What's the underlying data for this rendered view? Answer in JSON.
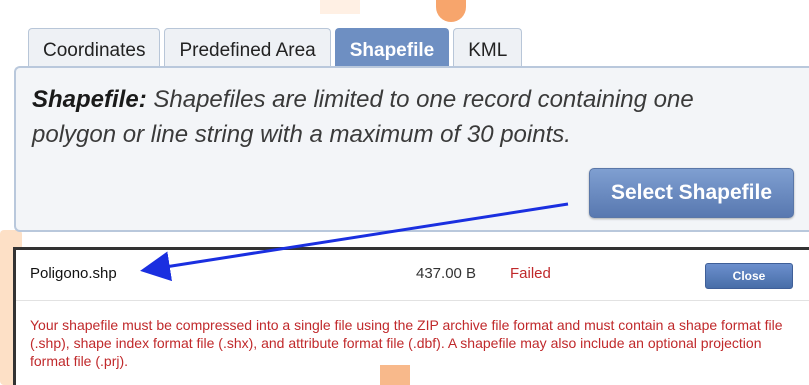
{
  "tabs": [
    {
      "label": "Coordinates",
      "active": false
    },
    {
      "label": "Predefined Area",
      "active": false
    },
    {
      "label": "Shapefile",
      "active": true
    },
    {
      "label": "KML",
      "active": false
    }
  ],
  "panel": {
    "heading": "Shapefile:",
    "description": " Shapefiles are limited to one record containing one polygon or line string with a maximum of 30 points.",
    "select_button": "Select Shapefile"
  },
  "file": {
    "name": "Poligono.shp",
    "size": "437.00 B",
    "status": "Failed",
    "close_button": "Close",
    "error": "Your shapefile must be compressed into a single file using the ZIP archive file format and must contain a shape format file (.shp), shape index format file (.shx), and attribute format file (.dbf). A shapefile may also include an optional projection format file (.prj)."
  },
  "colors": {
    "accent": "#6e8fc2",
    "error": "#c0292b",
    "annotation_arrow": "#1a2fe0"
  }
}
